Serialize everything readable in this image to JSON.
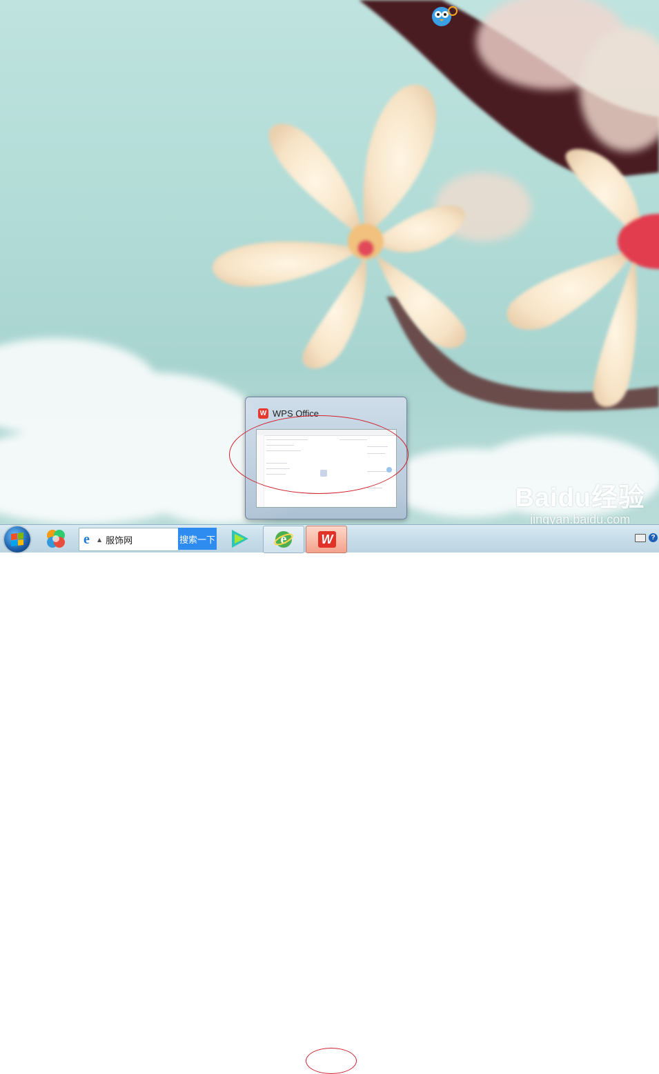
{
  "preview": {
    "title": "WPS Office",
    "thumb_title": "WPS Office"
  },
  "taskbar": {
    "search_value": "服饰网",
    "search_button": "搜索一下",
    "tray_help": "?"
  },
  "watermark": {
    "logo": "Baidu经验",
    "url": "jingyan.baidu.com"
  },
  "icons": {
    "start": "windows-start-icon",
    "app1": "colorful-ball-icon",
    "ie": "ie-icon",
    "player": "play-icon",
    "browser": "ie-360-icon",
    "wps": "wps-icon",
    "keyboard": "keyboard-icon",
    "help": "help-icon"
  },
  "colors": {
    "annotation": "#d21f2a",
    "wps": "#e23228",
    "search_button": "#2e8bef"
  }
}
